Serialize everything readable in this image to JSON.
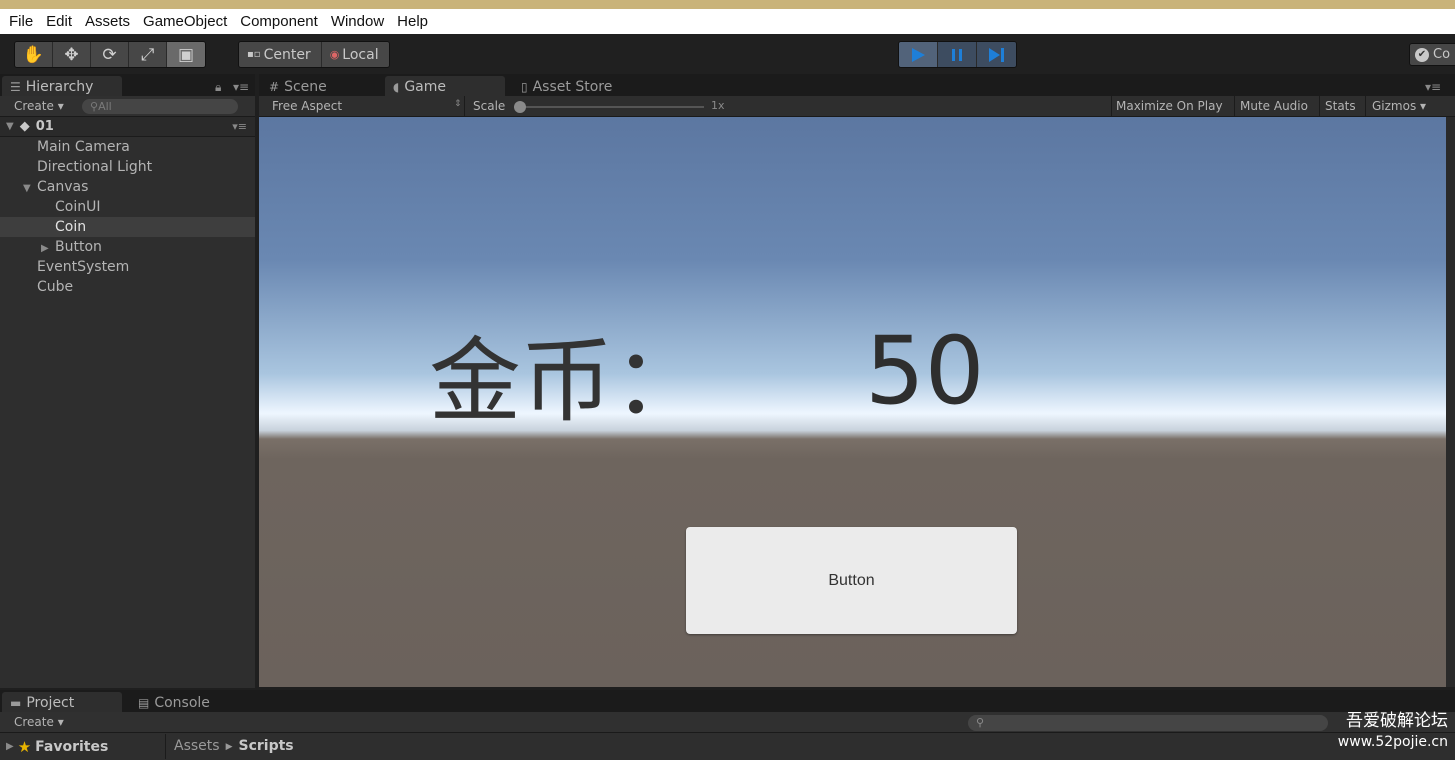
{
  "menu": [
    "File",
    "Edit",
    "Assets",
    "GameObject",
    "Component",
    "Window",
    "Help"
  ],
  "toolbar": {
    "tools": [
      "hand-icon",
      "move-icon",
      "rotate-icon",
      "scale-icon",
      "rect-tool-icon"
    ],
    "pivot": "Center",
    "space": "Local",
    "collab": "Co"
  },
  "hierarchy": {
    "tab": "Hierarchy",
    "create": "Create",
    "search_placeholder": "All",
    "scene": "01",
    "items": [
      "Main Camera",
      "Directional Light",
      "Canvas",
      "CoinUI",
      "Coin",
      "Button",
      "EventSystem",
      "Cube"
    ],
    "selected": "Coin"
  },
  "tabs": {
    "scene": "Scene",
    "game": "Game",
    "store": "Asset Store"
  },
  "gamebar": {
    "aspect": "Free Aspect",
    "scale_label": "Scale",
    "scale_value": "1x",
    "maximize": "Maximize On Play",
    "mute": "Mute Audio",
    "stats": "Stats",
    "gizmos": "Gizmos"
  },
  "game": {
    "coin_label": "金币：",
    "coin_value": "50",
    "button_label": "Button"
  },
  "project": {
    "tab": "Project",
    "console_tab": "Console",
    "create": "Create",
    "favorites": "Favorites",
    "breadcrumb": [
      "Assets",
      "Scripts"
    ]
  },
  "watermark": {
    "line1": "吾爱破解论坛",
    "line2": "www.52pojie.cn"
  },
  "colors": {
    "play_accent": "#1e7fd8",
    "editor_bg": "#2e2e2e",
    "menubar": "#ffffff"
  }
}
